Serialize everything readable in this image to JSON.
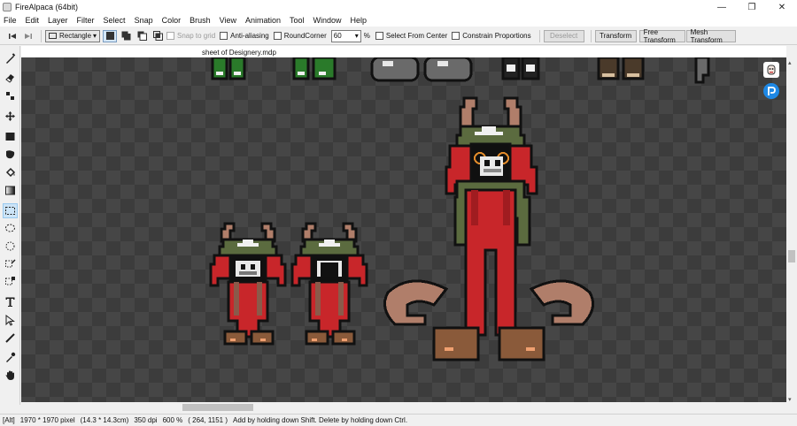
{
  "window": {
    "title": "FireAlpaca (64bit)",
    "minimize": "—",
    "maximize": "❐",
    "close": "✕"
  },
  "menu": [
    "File",
    "Edit",
    "Layer",
    "Filter",
    "Select",
    "Snap",
    "Color",
    "Brush",
    "View",
    "Animation",
    "Tool",
    "Window",
    "Help"
  ],
  "toolbar": {
    "shape_select": "Rectangle",
    "snap_to_grid": "Snap to grid",
    "anti_aliasing": "Anti-aliasing",
    "round_corner": "RoundCorner",
    "round_value": "60",
    "percent": "%",
    "select_from_center": "Select From Center",
    "constrain": "Constrain Proportions",
    "deselect": "Deselect",
    "transform": "Transform",
    "free_transform": "Free Transform",
    "mesh_transform": "Mesh Transform"
  },
  "document": {
    "tab_name": "sheet of Designery.mdp"
  },
  "status": {
    "key": "[Alt]",
    "size": "1970 * 1970 pixel",
    "cm": "(14.3 * 14.3cm)",
    "dpi": "350 dpi",
    "zoom": "600 %",
    "coords": "( 264, 1151 )",
    "hint": "Add by holding down Shift. Delete by holding down Ctrl."
  },
  "colors": {
    "accent": "#0078d7",
    "canvas_dark": "#464646",
    "canvas_light": "#3c3c3c",
    "outfit_red": "#c8262a",
    "hat_green": "#5b6b3f",
    "ear_tan": "#b07e6a"
  }
}
